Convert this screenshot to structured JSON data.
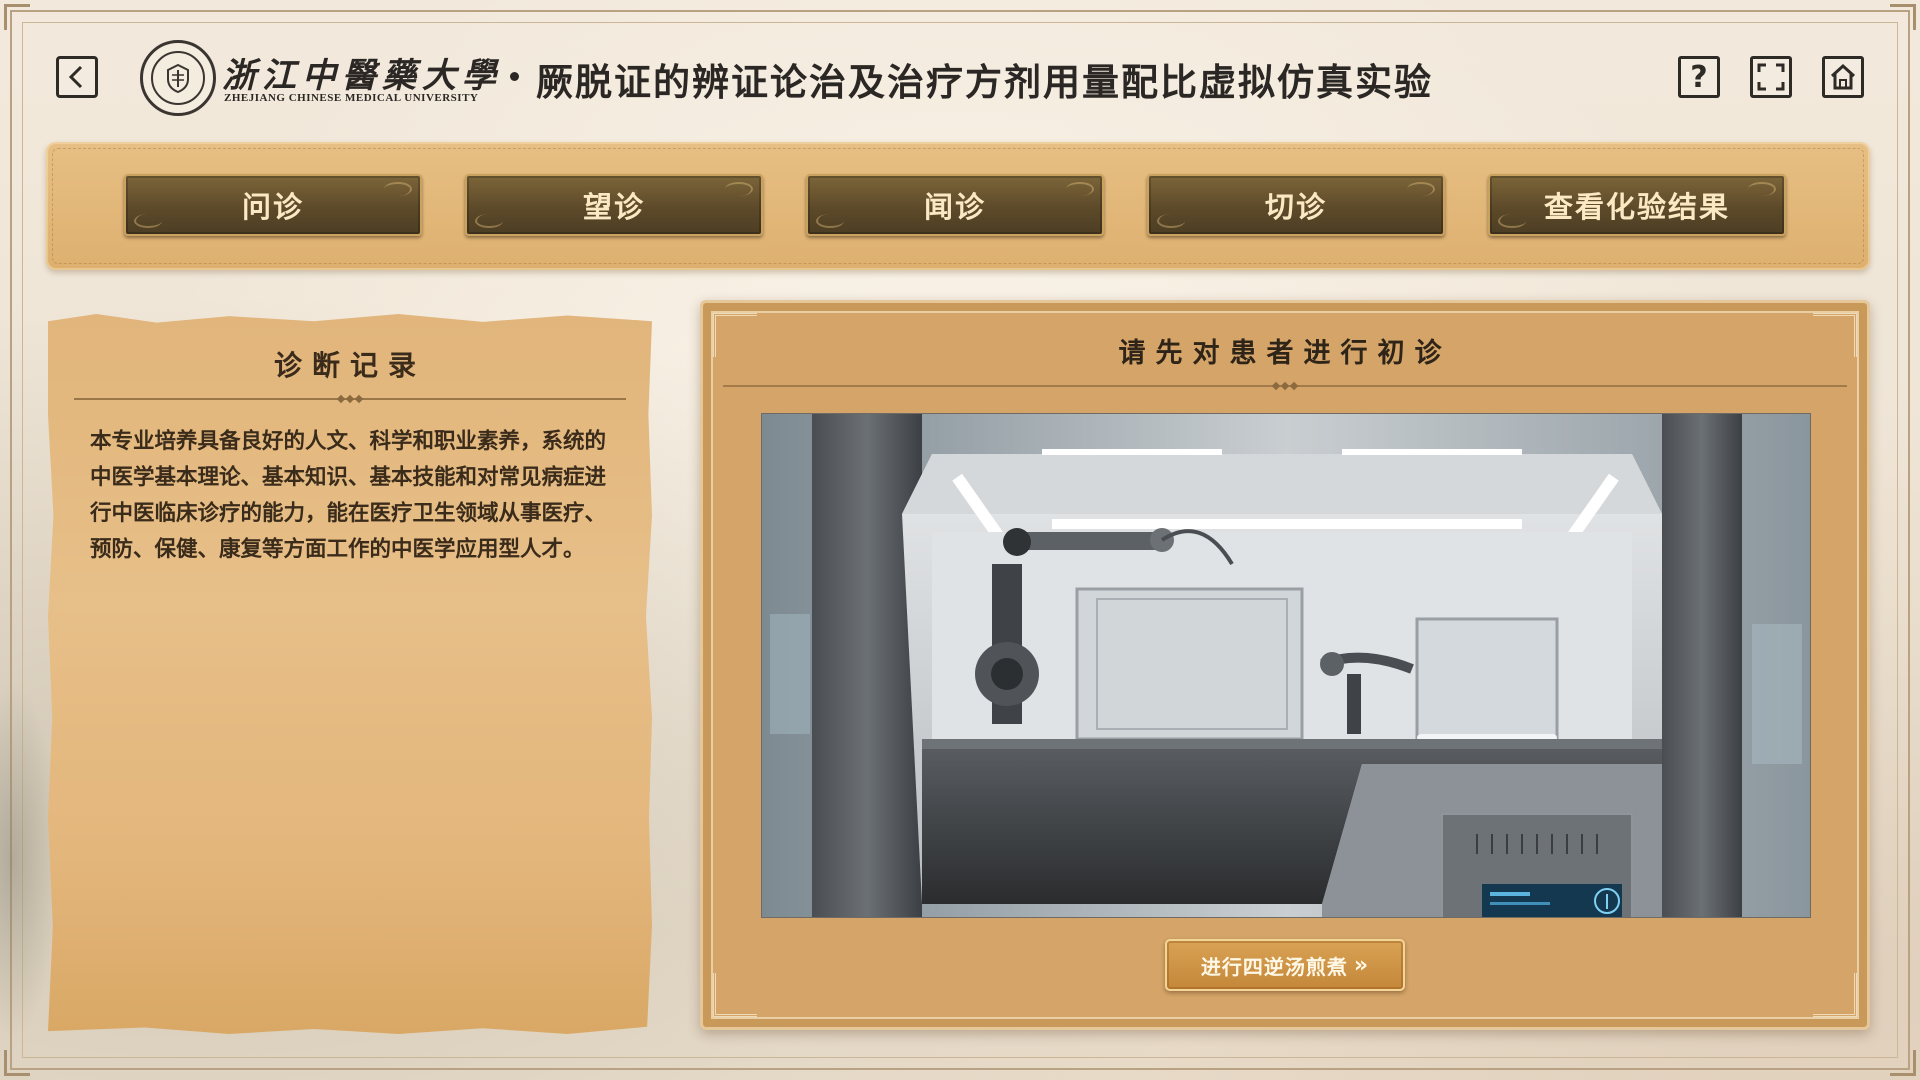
{
  "header": {
    "university_name": "浙江中醫藥大學",
    "university_english": "ZHEJIANG CHINESE MEDICAL UNIVERSITY",
    "title": "厥脱证的辨证论治及治疗方剂用量配比虚拟仿真实验",
    "icons": {
      "back": "back-icon",
      "help": "help-icon",
      "fullscreen": "fullscreen-icon",
      "home": "home-icon"
    },
    "help_glyph": "?"
  },
  "nav": {
    "tabs": [
      {
        "label": "问诊"
      },
      {
        "label": "望诊"
      },
      {
        "label": "闻诊"
      },
      {
        "label": "切诊"
      },
      {
        "label": "查看化验结果"
      }
    ]
  },
  "record_panel": {
    "title": "诊断记录",
    "text": "本专业培养具备良好的人文、科学和职业素养，系统的中医学基本理论、基本知识、基本技能和对常见病症进行中医临床诊疗的能力，能在医疗卫生领域从事医疗、预防、保健、康复等方面工作的中医学应用型人才。"
  },
  "main_panel": {
    "title": "请先对患者进行初诊",
    "action_label": "进行四逆汤煎煮",
    "action_arrows": "»"
  },
  "colors": {
    "nav_bar": "#ddb06f",
    "nav_button": "#5d4a2a",
    "nav_text": "#fbe9c3",
    "paper": "#e3b67c",
    "panel": "#d4a468",
    "action_button": "#c4873a",
    "text_dark": "#2b2724"
  }
}
